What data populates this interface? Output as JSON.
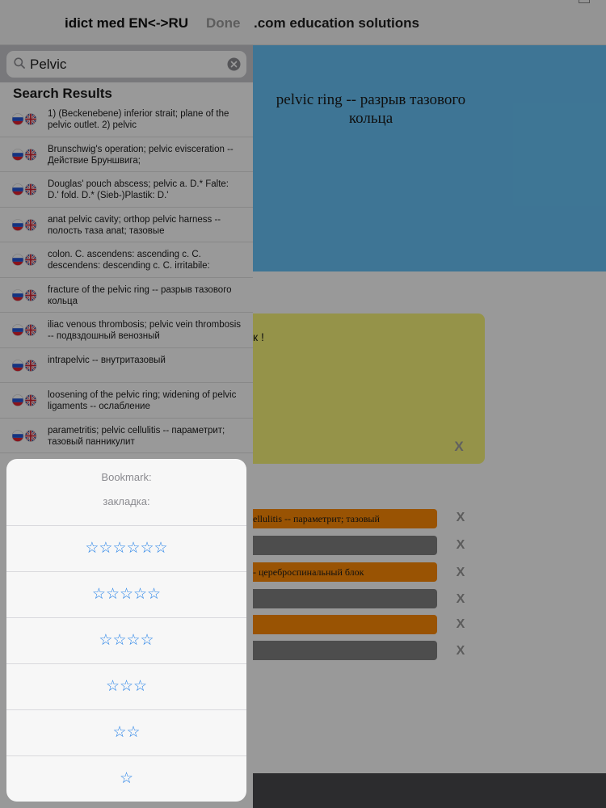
{
  "background_page": {
    "header_title": ".com education solutions",
    "hero_text": "pelvic ring -- разрыв тазового кольца",
    "note_text": "к !",
    "note_close": "X",
    "bars": [
      {
        "text": "ellulitis -- параметрит; тазовый",
        "color": "#ff8a05",
        "close": "X"
      },
      {
        "text": "",
        "color": "#808080",
        "close": "X"
      },
      {
        "text": "- цереброспинальный блок",
        "color": "#ff8a05",
        "close": "X"
      },
      {
        "text": "",
        "color": "#808080",
        "close": "X"
      },
      {
        "text": "",
        "color": "#ff8a05",
        "close": "X"
      },
      {
        "text": "",
        "color": "#808080",
        "close": "X"
      }
    ]
  },
  "panel": {
    "title": "idict med EN<->RU",
    "done_label": "Done",
    "search": {
      "value": "Pelvic",
      "placeholder": "Search"
    },
    "results_heading": "Search Results",
    "results": [
      {
        "flags": "ru-en",
        "text": "1) (Beckenebene) inferior strait; plane of the pelvic outlet. 2) pelvic"
      },
      {
        "flags": "ru-en",
        "text": "Brunschwig's operation; pelvic evisceration -- Действие Бруншвига;"
      },
      {
        "flags": "ru-en",
        "text": "Douglas' pouch abscess; pelvic a. D.* Falte: D.' fold. D.* (Sieb-)Plastik: D.'"
      },
      {
        "flags": "ru-en",
        "text": "anat pelvic cavity; orthop pelvic harness -- полость таза anat; тазовые"
      },
      {
        "flags": "ru-en",
        "text": "colon. C. ascendens: ascending c. C. descendens: descending c. C. irritabile:"
      },
      {
        "flags": "ru-en",
        "text": "fracture of the pelvic ring -- разрыв тазового кольца"
      },
      {
        "flags": "ru-en",
        "text": "iliac venous thrombosis; pelvic vein thrombosis -- подвздошный венозный"
      },
      {
        "flags": "ru-en",
        "text": "intrapelvic -- внутритазовый"
      },
      {
        "flags": "ru-en",
        "text": "loosening of the pelvic ring; widening of pelvic ligaments -- ослабление"
      },
      {
        "flags": "ru-en",
        "text": "parametritis; pelvic cellulitis -- параметрит; тазовый панникулит"
      }
    ]
  },
  "bookmark_sheet": {
    "title": "Bookmark:",
    "subtitle": "закладка:",
    "options": [
      {
        "label": "☆☆☆☆☆☆",
        "rating": 6
      },
      {
        "label": "☆☆☆☆☆",
        "rating": 5
      },
      {
        "label": "☆☆☆☆",
        "rating": 4
      },
      {
        "label": "☆☆☆",
        "rating": 3
      },
      {
        "label": "☆☆",
        "rating": 2
      },
      {
        "label": "☆",
        "rating": 1
      }
    ]
  },
  "colors": {
    "hero_blue": "#68c4f8",
    "note_yellow": "#f9f57a",
    "bar_orange": "#ff8a05",
    "bar_gray": "#808080",
    "accent_blue": "#2a84e8"
  }
}
